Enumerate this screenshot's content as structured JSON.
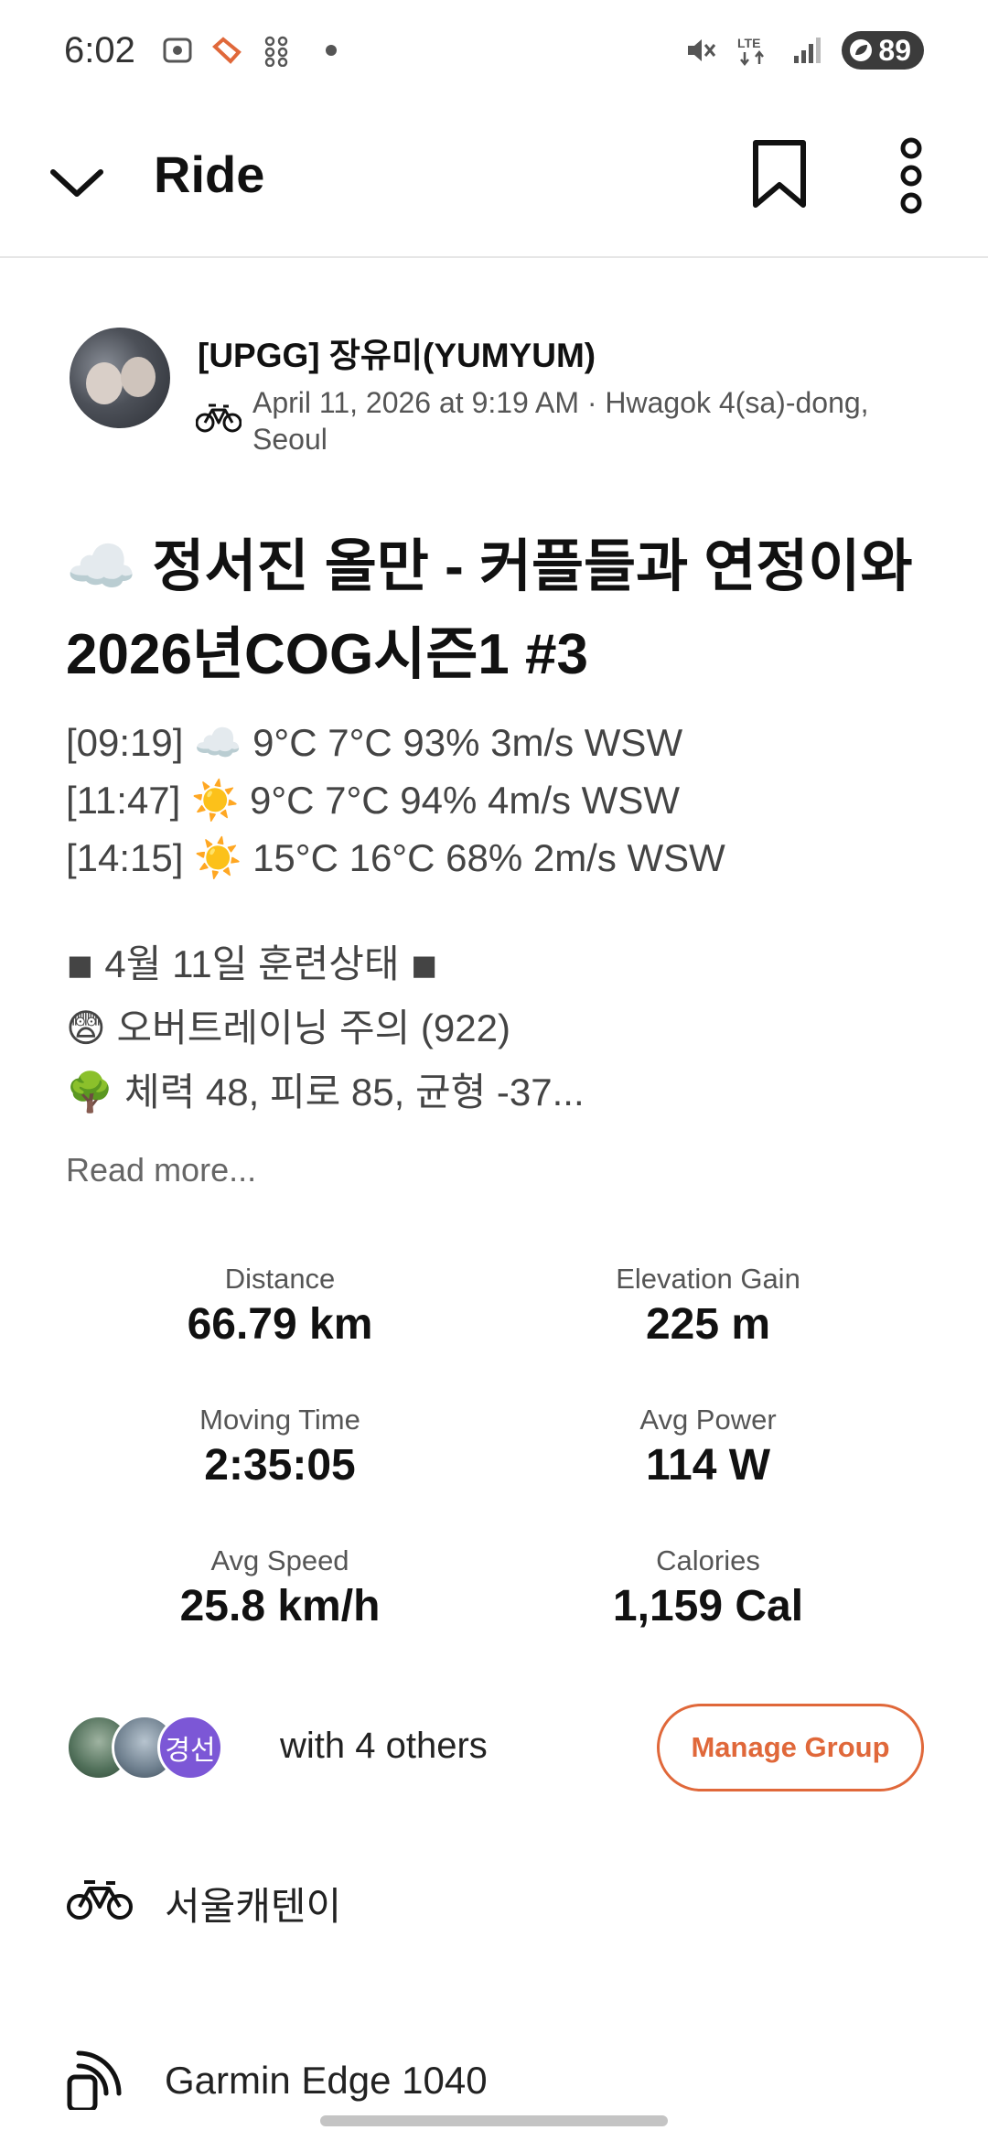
{
  "status_bar": {
    "time": "6:02",
    "network": "LTE",
    "battery": "89"
  },
  "header": {
    "title": "Ride"
  },
  "athlete": {
    "name": "[UPGG] 장유미(YUMYUM)",
    "meta": "April 11, 2026 at 9:19 AM · Hwagok 4(sa)-dong, Seoul"
  },
  "activity": {
    "title": "☁️ 정서진 올만 - 커플들과 연정이와 2026년COG시즌1 #3",
    "description": {
      "weather": [
        "[09:19] ☁️ 9°C 7°C 93% 3m/s  WSW",
        "[11:47] ☀️ 9°C 7°C 94% 4m/s  WSW",
        "[14:15] ☀️ 15°C 16°C 68% 2m/s  WSW"
      ],
      "training": [
        "◾ 4월 11일 훈련상태 ◾",
        "😨 오버트레이닝 주의 (922)",
        "🌳 체력 48, 피로 85, 균형 -37..."
      ]
    },
    "read_more": "Read more..."
  },
  "stats": [
    {
      "label": "Distance",
      "value": "66.79 km"
    },
    {
      "label": "Elevation Gain",
      "value": "225 m"
    },
    {
      "label": "Moving Time",
      "value": "2:35:05"
    },
    {
      "label": "Avg Power",
      "value": "114 W"
    },
    {
      "label": "Avg Speed",
      "value": "25.8 km/h"
    },
    {
      "label": "Calories",
      "value": "1,159 Cal"
    }
  ],
  "group": {
    "avatar3_text": "경선",
    "with_others": "with 4 others",
    "manage_label": "Manage Group"
  },
  "gear": {
    "bike": "서울캐텐이",
    "device": "Garmin Edge 1040"
  },
  "colors": {
    "accent": "#e0683a",
    "avatar3_bg": "#7c57d6"
  }
}
